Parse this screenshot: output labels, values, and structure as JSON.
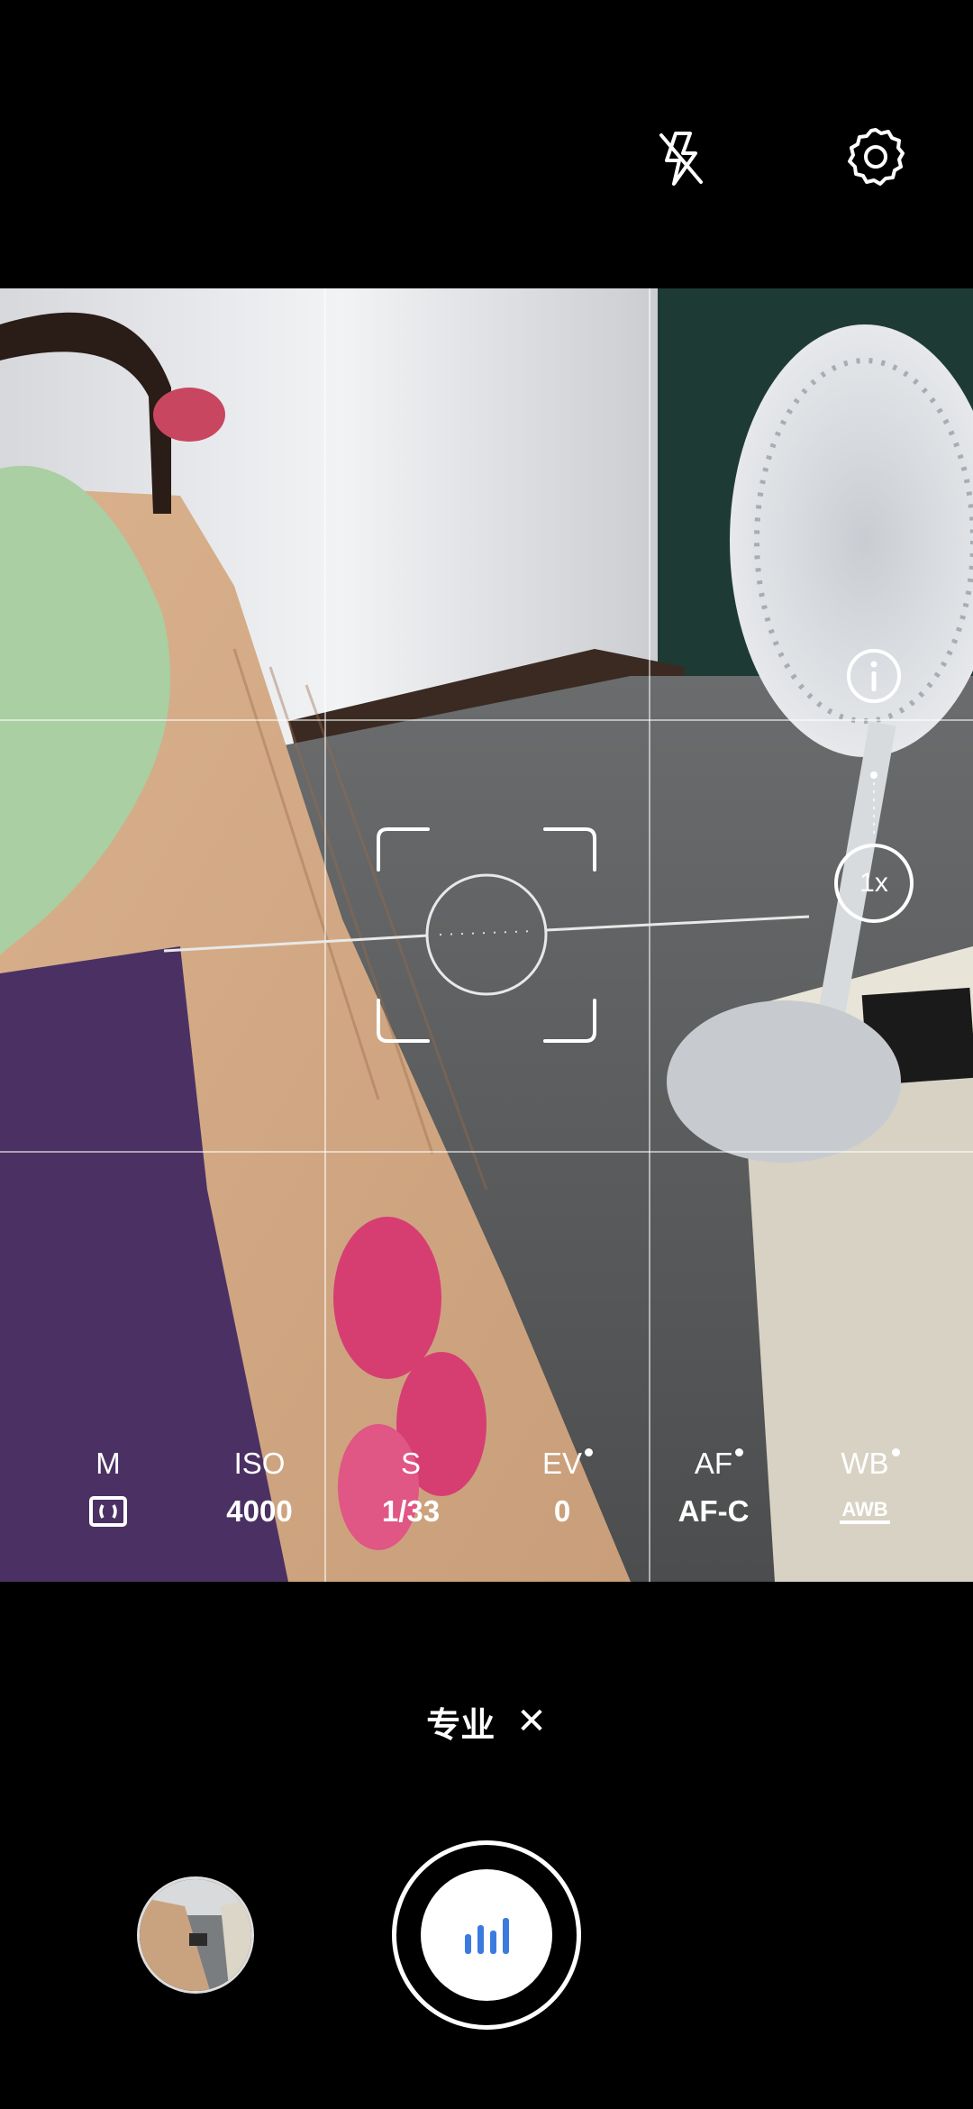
{
  "top_bar": {
    "flash_icon": "flash-off-icon",
    "settings_icon": "gear-icon"
  },
  "viewfinder": {
    "info_icon": "info-icon",
    "zoom_label": "1x",
    "grid": "3x3"
  },
  "pro_params": [
    {
      "label": "M",
      "value": "",
      "icon": "metering-matrix-icon",
      "dot": false
    },
    {
      "label": "ISO",
      "value": "4000",
      "dot": false
    },
    {
      "label": "S",
      "value": "1/33",
      "dot": false
    },
    {
      "label": "EV",
      "value": "0",
      "dot": true
    },
    {
      "label": "AF",
      "value": "AF-C",
      "dot": true
    },
    {
      "label": "WB",
      "value": "AWB",
      "dot": true
    }
  ],
  "mode": {
    "label": "专业",
    "close_label": "✕"
  },
  "bottom": {
    "shutter_icon": "audio-bars-icon",
    "shutter_color": "#3b7be0"
  }
}
